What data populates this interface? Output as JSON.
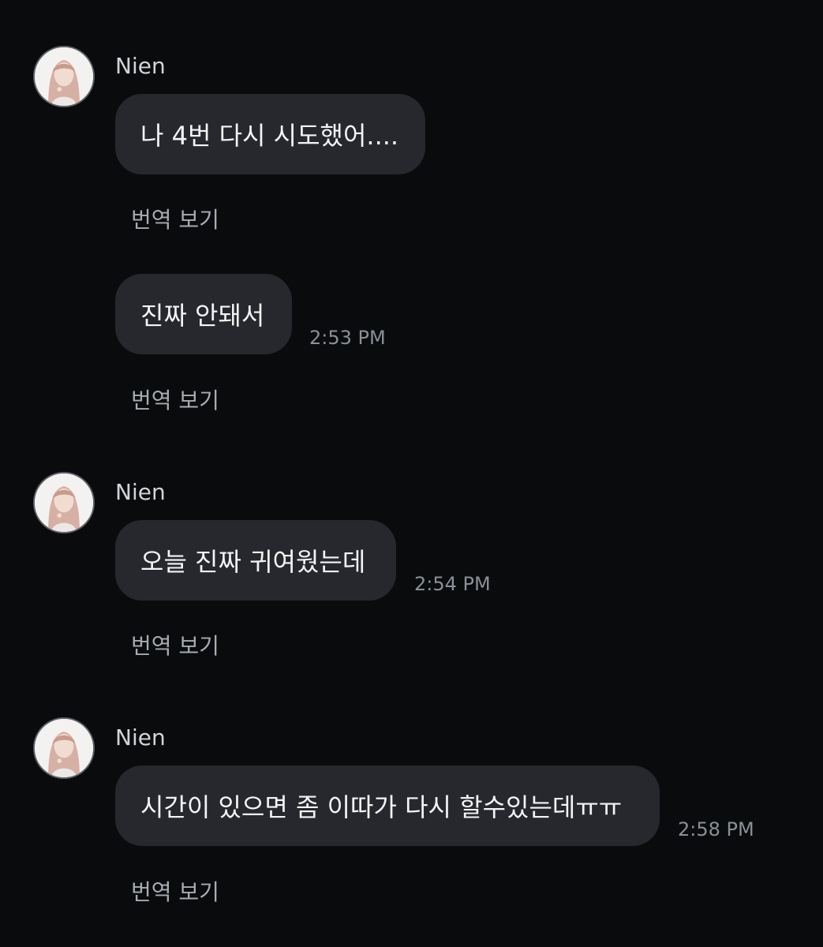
{
  "messages": [
    {
      "sender": "Nien",
      "text": "나 4번 다시 시도했어....",
      "time": "",
      "translate": "번역 보기"
    },
    {
      "sender": "",
      "text": "진짜 안돼서",
      "time": "2:53 PM",
      "translate": "번역 보기"
    },
    {
      "sender": "Nien",
      "text": "오늘 진짜 귀여웠는데",
      "time": "2:54 PM",
      "translate": "번역 보기"
    },
    {
      "sender": "Nien",
      "text": "시간이 있으면 좀 이따가 다시 할수있는데ㅠㅠ",
      "time": "2:58 PM",
      "translate": "번역 보기"
    }
  ],
  "icons": {
    "avatar": "profile-photo"
  },
  "colors": {
    "background": "#0a0b0d",
    "bubble": "#26282d",
    "text": "#f3f4f6",
    "timestamp": "#8b8f96"
  }
}
